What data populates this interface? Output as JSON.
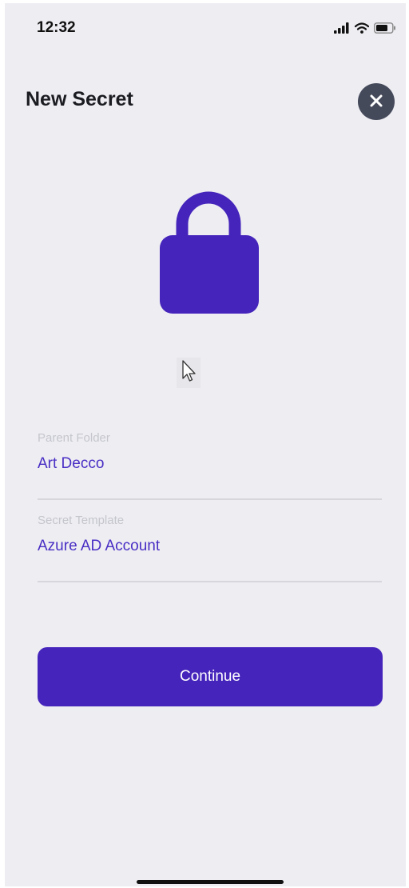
{
  "status_bar": {
    "time": "12:32",
    "icons": [
      "signal-icon",
      "wifi-icon",
      "battery-icon"
    ]
  },
  "header": {
    "title": "New Secret",
    "close_icon": "close-icon"
  },
  "hero": {
    "icon": "lock-icon"
  },
  "form": {
    "parent_folder": {
      "label": "Parent Folder",
      "value": "Art Decco"
    },
    "secret_template": {
      "label": "Secret Template",
      "value": "Azure AD Account"
    }
  },
  "actions": {
    "continue_label": "Continue"
  },
  "colors": {
    "accent": "#4524bb",
    "background": "#ededf2",
    "close_button": "#454a5b",
    "field_label": "#c5c6cd",
    "field_value": "#4a2ec4"
  }
}
